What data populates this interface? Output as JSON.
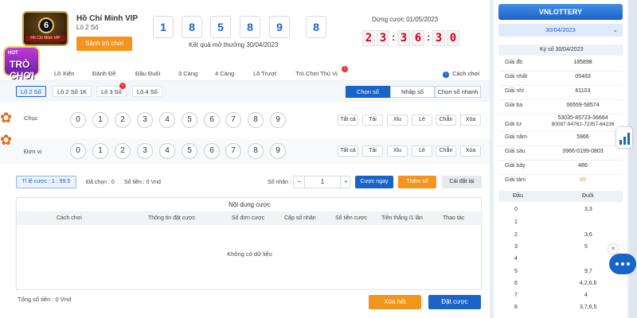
{
  "header": {
    "title": "Hồ Chí Minh VIP",
    "subtitle": "Lô 2 Số",
    "logo_caption": "Hồ Chí Minh VIP",
    "logo_number": "6",
    "play_button": "Sảnh trò chơi",
    "result_digits": [
      "1",
      "8",
      "5",
      "8",
      "9",
      "8"
    ],
    "result_label": "Kết quả mở thưởng 30/04/2023",
    "stop_label": "Dừng cược 01/05/2023",
    "countdown": [
      "2",
      "3",
      "3",
      "6",
      "3",
      "0"
    ],
    "badge_top": "HOT",
    "badge_text": "TRÒ CHƠI"
  },
  "menu": {
    "items": [
      "Lô Xiên",
      "Đánh Đề",
      "Đầu Đuôi",
      "3 Càng",
      "4 Càng",
      "Lô Trượt",
      "Trò Chơi Thú Vị"
    ],
    "help": "Cách chơi"
  },
  "sub_tabs": [
    "Lô 2 Số",
    "Lô 2 Số 1K",
    "Lô 3 Số",
    "Lô 4 Số"
  ],
  "modes": [
    "Chọn số",
    "Nhập số",
    "Chọn số nhanh"
  ],
  "grid": {
    "rows": [
      "Chục",
      "Đơn vị"
    ],
    "numbers": [
      "0",
      "1",
      "2",
      "3",
      "4",
      "5",
      "6",
      "7",
      "8",
      "9"
    ],
    "quick": [
      "Tất cả",
      "Tài",
      "Xỉu",
      "Lẻ",
      "Chẵn",
      "Xóa"
    ]
  },
  "options": {
    "rate": "Tỉ lệ cược : 1 : 99.5",
    "selected": "Đã chọn : 0",
    "amount": "Số tiền : 0 Vnd",
    "multiplier_label": "Số nhân :",
    "multiplier_value": "1",
    "minus": "−",
    "plus": "+",
    "bet_now": "Cược ngay",
    "add_number": "Thêm số",
    "reset": "Cài đặt lại"
  },
  "table": {
    "title": "Nội dung cược",
    "headers": [
      "Cách chơi",
      "Thông tin đặt cược",
      "Số đơn cược",
      "Cấp số nhân",
      "Số tiền cược",
      "Tiền thắng /1 lần",
      "Thao tác"
    ],
    "empty": "Không có dữ liệu"
  },
  "footer": {
    "total": "Tổng số tiền : 0 Vnd",
    "clear": "Xóa hết",
    "place_bet": "Đặt cược"
  },
  "sidebar": {
    "brand": "VNLOTTERY",
    "date": "30/04/2023",
    "ks_title": "Kỳ số 30/04/2023",
    "prizes": [
      {
        "label": "Giải đb",
        "value": "185898"
      },
      {
        "label": "Giải nhất",
        "value": "05483"
      },
      {
        "label": "Giải nhì",
        "value": "61103"
      },
      {
        "label": "Giải ba",
        "value": "06559-58574"
      },
      {
        "label": "Giải tư",
        "value": "53035-85723-36664"
      },
      {
        "label": "",
        "value": "80087-94762-72357-64226"
      },
      {
        "label": "Giải năm",
        "value": "5966"
      },
      {
        "label": "Giải sáu",
        "value": "3966-0199-0803"
      },
      {
        "label": "Giải bảy",
        "value": "486"
      },
      {
        "label": "Giải tám",
        "value": "85"
      }
    ],
    "dd_headers": [
      "Đầu",
      "Đuôi"
    ],
    "dd_rows": [
      {
        "dau": "0",
        "duoi": "3,3"
      },
      {
        "dau": "1",
        "duoi": ""
      },
      {
        "dau": "2",
        "duoi": "3,6"
      },
      {
        "dau": "3",
        "duoi": "5"
      },
      {
        "dau": "4",
        "duoi": ""
      },
      {
        "dau": "5",
        "duoi": "9,7"
      },
      {
        "dau": "6",
        "duoi": "4,2,6,6"
      },
      {
        "dau": "7",
        "duoi": "4"
      },
      {
        "dau": "8",
        "duoi": "3,7,6,5"
      }
    ]
  },
  "colors": {
    "primary": "#1a63c7",
    "orange": "#f5941d",
    "red": "#d0021b"
  },
  "icons": [
    "info-icon",
    "chevron-down-icon",
    "chart-icon",
    "chat-icon",
    "close-icon",
    "leaf-icon"
  ]
}
